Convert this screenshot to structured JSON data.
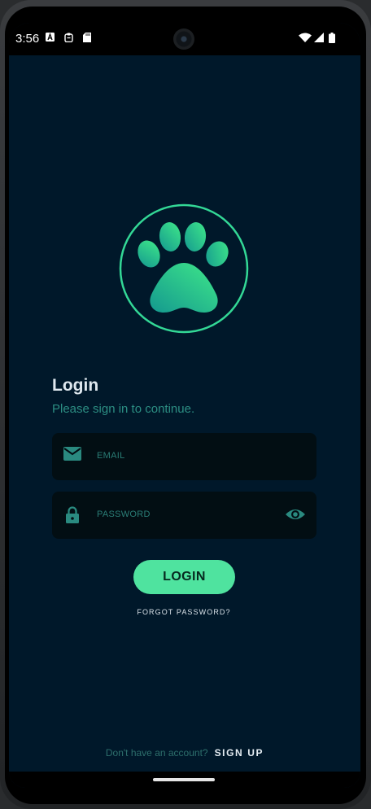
{
  "status_bar": {
    "time": "3:56",
    "left_icons": [
      "a-badge-icon",
      "clipboard-icon",
      "sd-card-icon"
    ],
    "right_icons": [
      "wifi-icon",
      "signal-icon",
      "battery-icon"
    ]
  },
  "login": {
    "title": "Login",
    "subtitle": "Please sign in to continue.",
    "email_placeholder": "EMAIL",
    "password_placeholder": "PASSWORD",
    "login_button": "LOGIN",
    "forgot_password": "FORGOT PASSWORD?"
  },
  "footer": {
    "prompt": "Don't have an account?",
    "signup": "SIGN UP"
  },
  "colors": {
    "background": "#00182a",
    "accent": "#4fe39f",
    "field_bg": "#020e13",
    "teal_text": "#2c8e83"
  }
}
